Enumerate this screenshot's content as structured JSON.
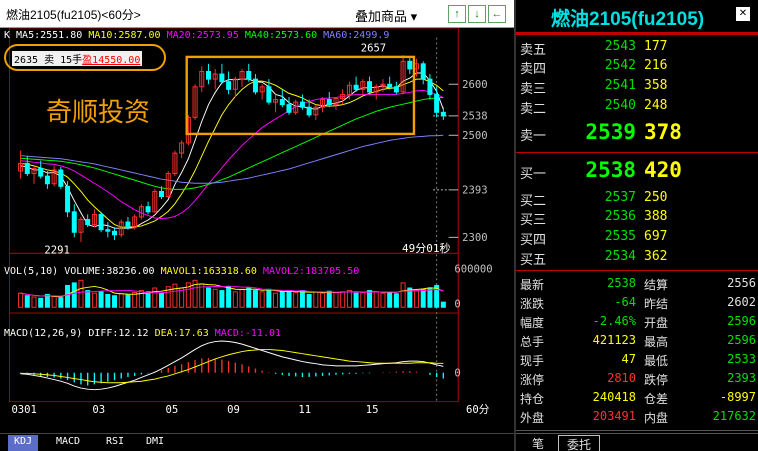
{
  "header": {
    "title": "燃油2105(fu2105)<60分>",
    "dropdown_label": "叠加商品 ▾",
    "nav_buttons": [
      "↑",
      "↓",
      "←",
      "→",
      "↖",
      "⊞"
    ]
  },
  "indicators": {
    "ma_line": "K MA5:2551.80 MA10:2587.00 MA20:2573.95 MA40:2573.60 MA60:2499.95",
    "ma5_label": "K MA5:2551.80",
    "ma10_label": "MA10:2587.00",
    "ma20_label": "MA20:2573.95",
    "ma40_label": "MA40:2573.60",
    "ma60_label": "MA60:2499.9",
    "trade_note_prefix": "2635 卖 15手",
    "trade_note_profit": "盈14550.00",
    "watermark": "奇顺投资",
    "vol_label": "VOL(5,10)",
    "volume_label": "VOLUME:38236.00",
    "mavol1_label": "MAVOL1:163318.60",
    "mavol2_label": "MAVOL2:183705.50",
    "macd_label": "MACD(12,26,9)",
    "diff_label": "DIFF:12.12",
    "dea_label": "DEA:17.63",
    "macd_val_label": "MACD:-11.01",
    "countdown": "49分01秒"
  },
  "colors": {
    "up": "#ff3030",
    "down": "#00ffff",
    "ma5": "#ffffff",
    "ma10": "#ffff00",
    "ma20": "#ff00ff",
    "ma40": "#00ff00",
    "ma60": "#8080ff",
    "highlight": "#f0a000"
  },
  "chart_data": {
    "type": "candlestick",
    "price_axis_ticks": [
      "2600",
      "2538",
      "2500",
      "2393",
      "2300"
    ],
    "price_axis_values": [
      2600,
      2538,
      2500,
      2393,
      2300
    ],
    "ylim": [
      2280,
      2680
    ],
    "annotations": [
      {
        "label": "2657",
        "value": 2657
      },
      {
        "label": "2291",
        "value": 2291
      }
    ],
    "volume_axis_ticks": [
      "600000",
      "0"
    ],
    "macd_axis_ticks": [
      "0"
    ],
    "x_ticks": [
      "0301",
      "03",
      "05",
      "09",
      "11",
      "15",
      "60分"
    ],
    "candles": [
      {
        "o": 2430,
        "h": 2470,
        "l": 2415,
        "c": 2445
      },
      {
        "o": 2445,
        "h": 2460,
        "l": 2420,
        "c": 2425
      },
      {
        "o": 2425,
        "h": 2440,
        "l": 2405,
        "c": 2435
      },
      {
        "o": 2435,
        "h": 2450,
        "l": 2415,
        "c": 2420
      },
      {
        "o": 2420,
        "h": 2430,
        "l": 2395,
        "c": 2405
      },
      {
        "o": 2405,
        "h": 2440,
        "l": 2400,
        "c": 2432
      },
      {
        "o": 2432,
        "h": 2438,
        "l": 2395,
        "c": 2400
      },
      {
        "o": 2400,
        "h": 2410,
        "l": 2340,
        "c": 2350
      },
      {
        "o": 2350,
        "h": 2365,
        "l": 2300,
        "c": 2310
      },
      {
        "o": 2310,
        "h": 2340,
        "l": 2291,
        "c": 2335
      },
      {
        "o": 2335,
        "h": 2345,
        "l": 2320,
        "c": 2325
      },
      {
        "o": 2325,
        "h": 2355,
        "l": 2320,
        "c": 2345
      },
      {
        "o": 2345,
        "h": 2350,
        "l": 2310,
        "c": 2315
      },
      {
        "o": 2315,
        "h": 2330,
        "l": 2300,
        "c": 2312
      },
      {
        "o": 2312,
        "h": 2320,
        "l": 2295,
        "c": 2305
      },
      {
        "o": 2305,
        "h": 2335,
        "l": 2300,
        "c": 2330
      },
      {
        "o": 2330,
        "h": 2340,
        "l": 2315,
        "c": 2320
      },
      {
        "o": 2320,
        "h": 2345,
        "l": 2315,
        "c": 2340
      },
      {
        "o": 2340,
        "h": 2365,
        "l": 2335,
        "c": 2360
      },
      {
        "o": 2360,
        "h": 2370,
        "l": 2345,
        "c": 2350
      },
      {
        "o": 2350,
        "h": 2395,
        "l": 2348,
        "c": 2390
      },
      {
        "o": 2390,
        "h": 2400,
        "l": 2375,
        "c": 2380
      },
      {
        "o": 2380,
        "h": 2430,
        "l": 2378,
        "c": 2425
      },
      {
        "o": 2425,
        "h": 2470,
        "l": 2420,
        "c": 2465
      },
      {
        "o": 2465,
        "h": 2490,
        "l": 2455,
        "c": 2485
      },
      {
        "o": 2485,
        "h": 2540,
        "l": 2480,
        "c": 2535
      },
      {
        "o": 2535,
        "h": 2600,
        "l": 2530,
        "c": 2595
      },
      {
        "o": 2595,
        "h": 2635,
        "l": 2585,
        "c": 2625
      },
      {
        "o": 2625,
        "h": 2640,
        "l": 2600,
        "c": 2610
      },
      {
        "o": 2610,
        "h": 2630,
        "l": 2590,
        "c": 2620
      },
      {
        "o": 2620,
        "h": 2640,
        "l": 2600,
        "c": 2605
      },
      {
        "o": 2605,
        "h": 2625,
        "l": 2580,
        "c": 2590
      },
      {
        "o": 2590,
        "h": 2615,
        "l": 2575,
        "c": 2610
      },
      {
        "o": 2610,
        "h": 2630,
        "l": 2595,
        "c": 2625
      },
      {
        "o": 2625,
        "h": 2640,
        "l": 2605,
        "c": 2610
      },
      {
        "o": 2610,
        "h": 2620,
        "l": 2580,
        "c": 2585
      },
      {
        "o": 2585,
        "h": 2600,
        "l": 2570,
        "c": 2595
      },
      {
        "o": 2595,
        "h": 2610,
        "l": 2560,
        "c": 2565
      },
      {
        "o": 2565,
        "h": 2580,
        "l": 2545,
        "c": 2570
      },
      {
        "o": 2570,
        "h": 2590,
        "l": 2555,
        "c": 2560
      },
      {
        "o": 2560,
        "h": 2575,
        "l": 2540,
        "c": 2545
      },
      {
        "o": 2545,
        "h": 2570,
        "l": 2540,
        "c": 2565
      },
      {
        "o": 2565,
        "h": 2580,
        "l": 2550,
        "c": 2555
      },
      {
        "o": 2555,
        "h": 2570,
        "l": 2535,
        "c": 2540
      },
      {
        "o": 2540,
        "h": 2560,
        "l": 2530,
        "c": 2555
      },
      {
        "o": 2555,
        "h": 2575,
        "l": 2545,
        "c": 2570
      },
      {
        "o": 2570,
        "h": 2585,
        "l": 2555,
        "c": 2560
      },
      {
        "o": 2560,
        "h": 2575,
        "l": 2550,
        "c": 2572
      },
      {
        "o": 2572,
        "h": 2590,
        "l": 2560,
        "c": 2580
      },
      {
        "o": 2580,
        "h": 2605,
        "l": 2570,
        "c": 2598
      },
      {
        "o": 2598,
        "h": 2615,
        "l": 2585,
        "c": 2590
      },
      {
        "o": 2590,
        "h": 2610,
        "l": 2578,
        "c": 2605
      },
      {
        "o": 2605,
        "h": 2615,
        "l": 2580,
        "c": 2585
      },
      {
        "o": 2585,
        "h": 2600,
        "l": 2570,
        "c": 2595
      },
      {
        "o": 2595,
        "h": 2610,
        "l": 2585,
        "c": 2600
      },
      {
        "o": 2600,
        "h": 2615,
        "l": 2590,
        "c": 2595
      },
      {
        "o": 2595,
        "h": 2605,
        "l": 2580,
        "c": 2585
      },
      {
        "o": 2585,
        "h": 2657,
        "l": 2580,
        "c": 2645
      },
      {
        "o": 2645,
        "h": 2655,
        "l": 2620,
        "c": 2630
      },
      {
        "o": 2630,
        "h": 2650,
        "l": 2615,
        "c": 2640
      },
      {
        "o": 2640,
        "h": 2645,
        "l": 2600,
        "c": 2610
      },
      {
        "o": 2610,
        "h": 2620,
        "l": 2570,
        "c": 2580
      },
      {
        "o": 2580,
        "h": 2595,
        "l": 2535,
        "c": 2545
      },
      {
        "o": 2545,
        "h": 2555,
        "l": 2530,
        "c": 2538
      }
    ],
    "ma_series": [
      {
        "name": "MA5",
        "values": [
          2440,
          2438,
          2432,
          2432,
          2426,
          2427,
          2420,
          2398,
          2372,
          2348,
          2325,
          2321,
          2325,
          2323,
          2318,
          2318,
          2318,
          2319,
          2327,
          2334,
          2344,
          2358,
          2374,
          2404,
          2427,
          2454,
          2490,
          2527,
          2560,
          2584,
          2603,
          2609,
          2609,
          2610,
          2610,
          2605,
          2604,
          2595,
          2580,
          2576,
          2564,
          2557,
          2556,
          2553,
          2551,
          2557,
          2561,
          2563,
          2567,
          2577,
          2588,
          2593,
          2593,
          2594,
          2597,
          2592,
          2593,
          2606,
          2612,
          2622,
          2622,
          2607,
          2586,
          2551
        ]
      },
      {
        "name": "MA10",
        "values": [
          2445,
          2443,
          2440,
          2436,
          2432,
          2430,
          2426,
          2418,
          2405,
          2390,
          2373,
          2360,
          2348,
          2336,
          2325,
          2320,
          2320,
          2321,
          2322,
          2327,
          2332,
          2341,
          2351,
          2366,
          2385,
          2406,
          2431,
          2459,
          2488,
          2514,
          2540,
          2560,
          2576,
          2590,
          2600,
          2606,
          2606,
          2603,
          2598,
          2590,
          2582,
          2578,
          2573,
          2566,
          2560,
          2558,
          2557,
          2558,
          2560,
          2564,
          2570,
          2577,
          2582,
          2586,
          2590,
          2592,
          2593,
          2599,
          2604,
          2610,
          2610,
          2605,
          2598,
          2587
        ]
      },
      {
        "name": "MA20",
        "values": [
          2450,
          2449,
          2447,
          2446,
          2444,
          2443,
          2440,
          2436,
          2430,
          2422,
          2414,
          2406,
          2398,
          2389,
          2380,
          2370,
          2362,
          2354,
          2348,
          2343,
          2338,
          2337,
          2338,
          2341,
          2348,
          2358,
          2372,
          2388,
          2405,
          2420,
          2436,
          2452,
          2466,
          2480,
          2492,
          2504,
          2515,
          2524,
          2532,
          2540,
          2548,
          2556,
          2562,
          2566,
          2570,
          2572,
          2573,
          2574,
          2576,
          2578,
          2580,
          2580,
          2580,
          2580,
          2580,
          2580,
          2580,
          2582,
          2584,
          2587,
          2588,
          2585,
          2580,
          2574
        ]
      },
      {
        "name": "MA40",
        "values": [
          2455,
          2454,
          2453,
          2452,
          2451,
          2450,
          2449,
          2447,
          2445,
          2442,
          2439,
          2436,
          2432,
          2428,
          2424,
          2420,
          2416,
          2412,
          2408,
          2404,
          2400,
          2397,
          2395,
          2394,
          2394,
          2395,
          2397,
          2400,
          2404,
          2408,
          2413,
          2418,
          2424,
          2430,
          2436,
          2442,
          2448,
          2454,
          2460,
          2466,
          2472,
          2478,
          2484,
          2490,
          2496,
          2502,
          2508,
          2514,
          2520,
          2526,
          2532,
          2537,
          2542,
          2547,
          2551,
          2555,
          2558,
          2561,
          2564,
          2567,
          2570,
          2572,
          2573,
          2574
        ]
      },
      {
        "name": "MA60",
        "values": [
          2460,
          2459,
          2458,
          2457,
          2456,
          2455,
          2454,
          2452,
          2450,
          2448,
          2446,
          2444,
          2441,
          2438,
          2435,
          2432,
          2429,
          2426,
          2423,
          2420,
          2417,
          2414,
          2412,
          2410,
          2408,
          2407,
          2406,
          2406,
          2406,
          2407,
          2408,
          2410,
          2412,
          2414,
          2416,
          2419,
          2422,
          2425,
          2428,
          2431,
          2434,
          2438,
          2442,
          2446,
          2450,
          2454,
          2458,
          2462,
          2466,
          2470,
          2474,
          2478,
          2481,
          2484,
          2487,
          2490,
          2492,
          2494,
          2496,
          2497,
          2498,
          2499,
          2499,
          2500
        ]
      }
    ],
    "volume": [
      220,
      180,
      160,
      140,
      200,
      170,
      150,
      340,
      380,
      420,
      260,
      220,
      240,
      200,
      180,
      210,
      190,
      230,
      260,
      240,
      300,
      220,
      320,
      360,
      300,
      380,
      420,
      360,
      300,
      280,
      260,
      320,
      240,
      280,
      300,
      260,
      240,
      280,
      220,
      240,
      250,
      230,
      260,
      200,
      240,
      220,
      250,
      230,
      240,
      260,
      220,
      230,
      260,
      240,
      220,
      230,
      210,
      380,
      300,
      260,
      280,
      300,
      340,
      80
    ],
    "macd_bars": [
      -2,
      -3,
      -4,
      -6,
      -8,
      -9,
      -11,
      -14,
      -18,
      -22,
      -24,
      -22,
      -20,
      -17,
      -14,
      -11,
      -8,
      -6,
      -3,
      -1,
      2,
      5,
      9,
      13,
      16,
      20,
      24,
      27,
      28,
      27,
      25,
      22,
      19,
      16,
      12,
      8,
      4,
      1,
      -2,
      -4,
      -6,
      -7,
      -8,
      -8,
      -7,
      -6,
      -5,
      -4,
      -3,
      -2,
      -2,
      -1,
      -1,
      0,
      1,
      1,
      2,
      3,
      3,
      2,
      0,
      -4,
      -8,
      -11
    ],
    "diff": [
      -2,
      -3,
      -5,
      -7,
      -10,
      -13,
      -16,
      -20,
      -25,
      -29,
      -31,
      -32,
      -31,
      -29,
      -26,
      -22,
      -18,
      -14,
      -9,
      -4,
      1,
      7,
      14,
      21,
      28,
      36,
      44,
      51,
      56,
      59,
      60,
      59,
      57,
      54,
      50,
      46,
      42,
      38,
      34,
      30,
      27,
      24,
      21,
      19,
      17,
      15,
      14,
      13,
      13,
      13,
      13,
      14,
      15,
      16,
      17,
      18,
      19,
      21,
      22,
      22,
      21,
      18,
      15,
      12
    ],
    "dea": [
      -1,
      -1,
      -2,
      -3,
      -4,
      -5,
      -7,
      -9,
      -11,
      -13,
      -15,
      -17,
      -18,
      -19,
      -19,
      -19,
      -18,
      -17,
      -16,
      -14,
      -12,
      -9,
      -6,
      -2,
      2,
      6,
      11,
      16,
      21,
      26,
      30,
      34,
      37,
      40,
      42,
      43,
      44,
      44,
      43,
      42,
      40,
      38,
      36,
      34,
      32,
      30,
      28,
      26,
      24,
      22,
      21,
      20,
      19,
      18,
      18,
      18,
      18,
      18,
      18,
      19,
      19,
      19,
      18,
      17.63
    ]
  },
  "quote": {
    "title": "燃油2105(fu2105)",
    "asks": [
      {
        "label": "卖五",
        "price": "2543",
        "vol": "177"
      },
      {
        "label": "卖四",
        "price": "2542",
        "vol": "216"
      },
      {
        "label": "卖三",
        "price": "2541",
        "vol": "358"
      },
      {
        "label": "卖二",
        "price": "2540",
        "vol": "248"
      }
    ],
    "ask1": {
      "label": "卖一",
      "price": "2539",
      "vol": "378"
    },
    "bid1": {
      "label": "买一",
      "price": "2538",
      "vol": "420"
    },
    "bids": [
      {
        "label": "买二",
        "price": "2537",
        "vol": "250"
      },
      {
        "label": "买三",
        "price": "2536",
        "vol": "388"
      },
      {
        "label": "买四",
        "price": "2535",
        "vol": "697"
      },
      {
        "label": "买五",
        "price": "2534",
        "vol": "362"
      }
    ],
    "stats": [
      {
        "l1": "最新",
        "v1": "2538",
        "c1": "green",
        "l2": "结算",
        "v2": "2556",
        "c2": "white"
      },
      {
        "l1": "涨跌",
        "v1": "-64",
        "c1": "green",
        "l2": "昨结",
        "v2": "2602",
        "c2": "white"
      },
      {
        "l1": "幅度",
        "v1": "-2.46%",
        "c1": "green",
        "l2": "开盘",
        "v2": "2596",
        "c2": "green"
      },
      {
        "l1": "总手",
        "v1": "421123",
        "c1": "yellow",
        "l2": "最高",
        "v2": "2596",
        "c2": "green"
      },
      {
        "l1": "现手",
        "v1": "47",
        "c1": "yellow",
        "l2": "最低",
        "v2": "2533",
        "c2": "green"
      },
      {
        "l1": "涨停",
        "v1": "2810",
        "c1": "red",
        "l2": "跌停",
        "v2": "2393",
        "c2": "green"
      },
      {
        "l1": "持仓",
        "v1": "240418",
        "c1": "yellow",
        "l2": "仓差",
        "v2": "-8997",
        "c2": "yellow"
      },
      {
        "l1": "外盘",
        "v1": "203491",
        "c1": "red",
        "l2": "内盘",
        "v2": "217632",
        "c2": "green"
      }
    ],
    "tabs": [
      "笔",
      "委托"
    ]
  },
  "bottom_tabs": [
    "KDJ",
    "MACD",
    "RSI",
    "DMI"
  ]
}
